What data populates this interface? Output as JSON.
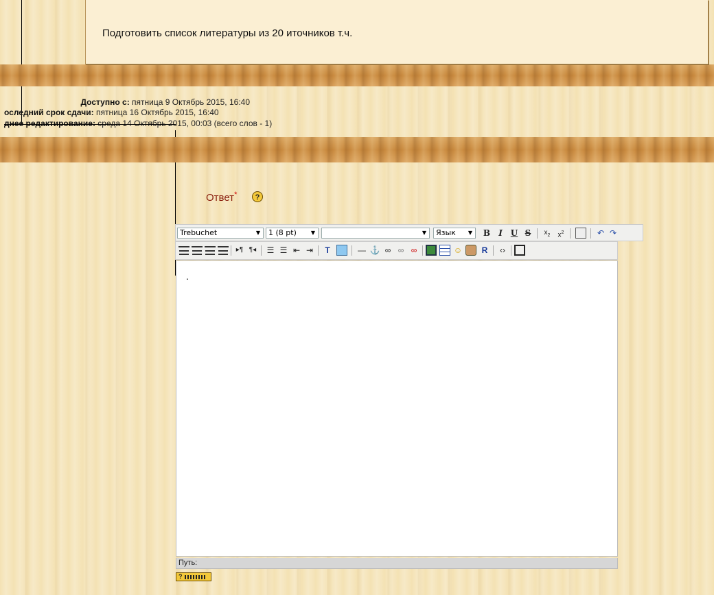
{
  "top_panel": {
    "text": "Подготовить список литературы из 20 иточников т.ч."
  },
  "info": {
    "available_label": "Доступно с:",
    "available_value": "пятница 9 Октябрь 2015, 16:40",
    "deadline_label": "оследний срок сдачи:",
    "deadline_value": "пятница 16 Октябрь 2015, 16:40",
    "edited_label": "днее редактирование:",
    "edited_value": "среда 14 Октябрь 2015, 00:03 (всего слов - 1)"
  },
  "answer": {
    "label": "Ответ",
    "required_mark": "*",
    "help_glyph": "?"
  },
  "editor": {
    "font_family_value": "Trebuchet",
    "font_size_value": "1 (8 pt)",
    "style_value": "",
    "language_value": "Язык",
    "bold": "B",
    "italic": "I",
    "underline": "U",
    "strike": "S",
    "content": ".",
    "path_label": "Путь:"
  },
  "kbd": {
    "help_glyph": "?"
  }
}
